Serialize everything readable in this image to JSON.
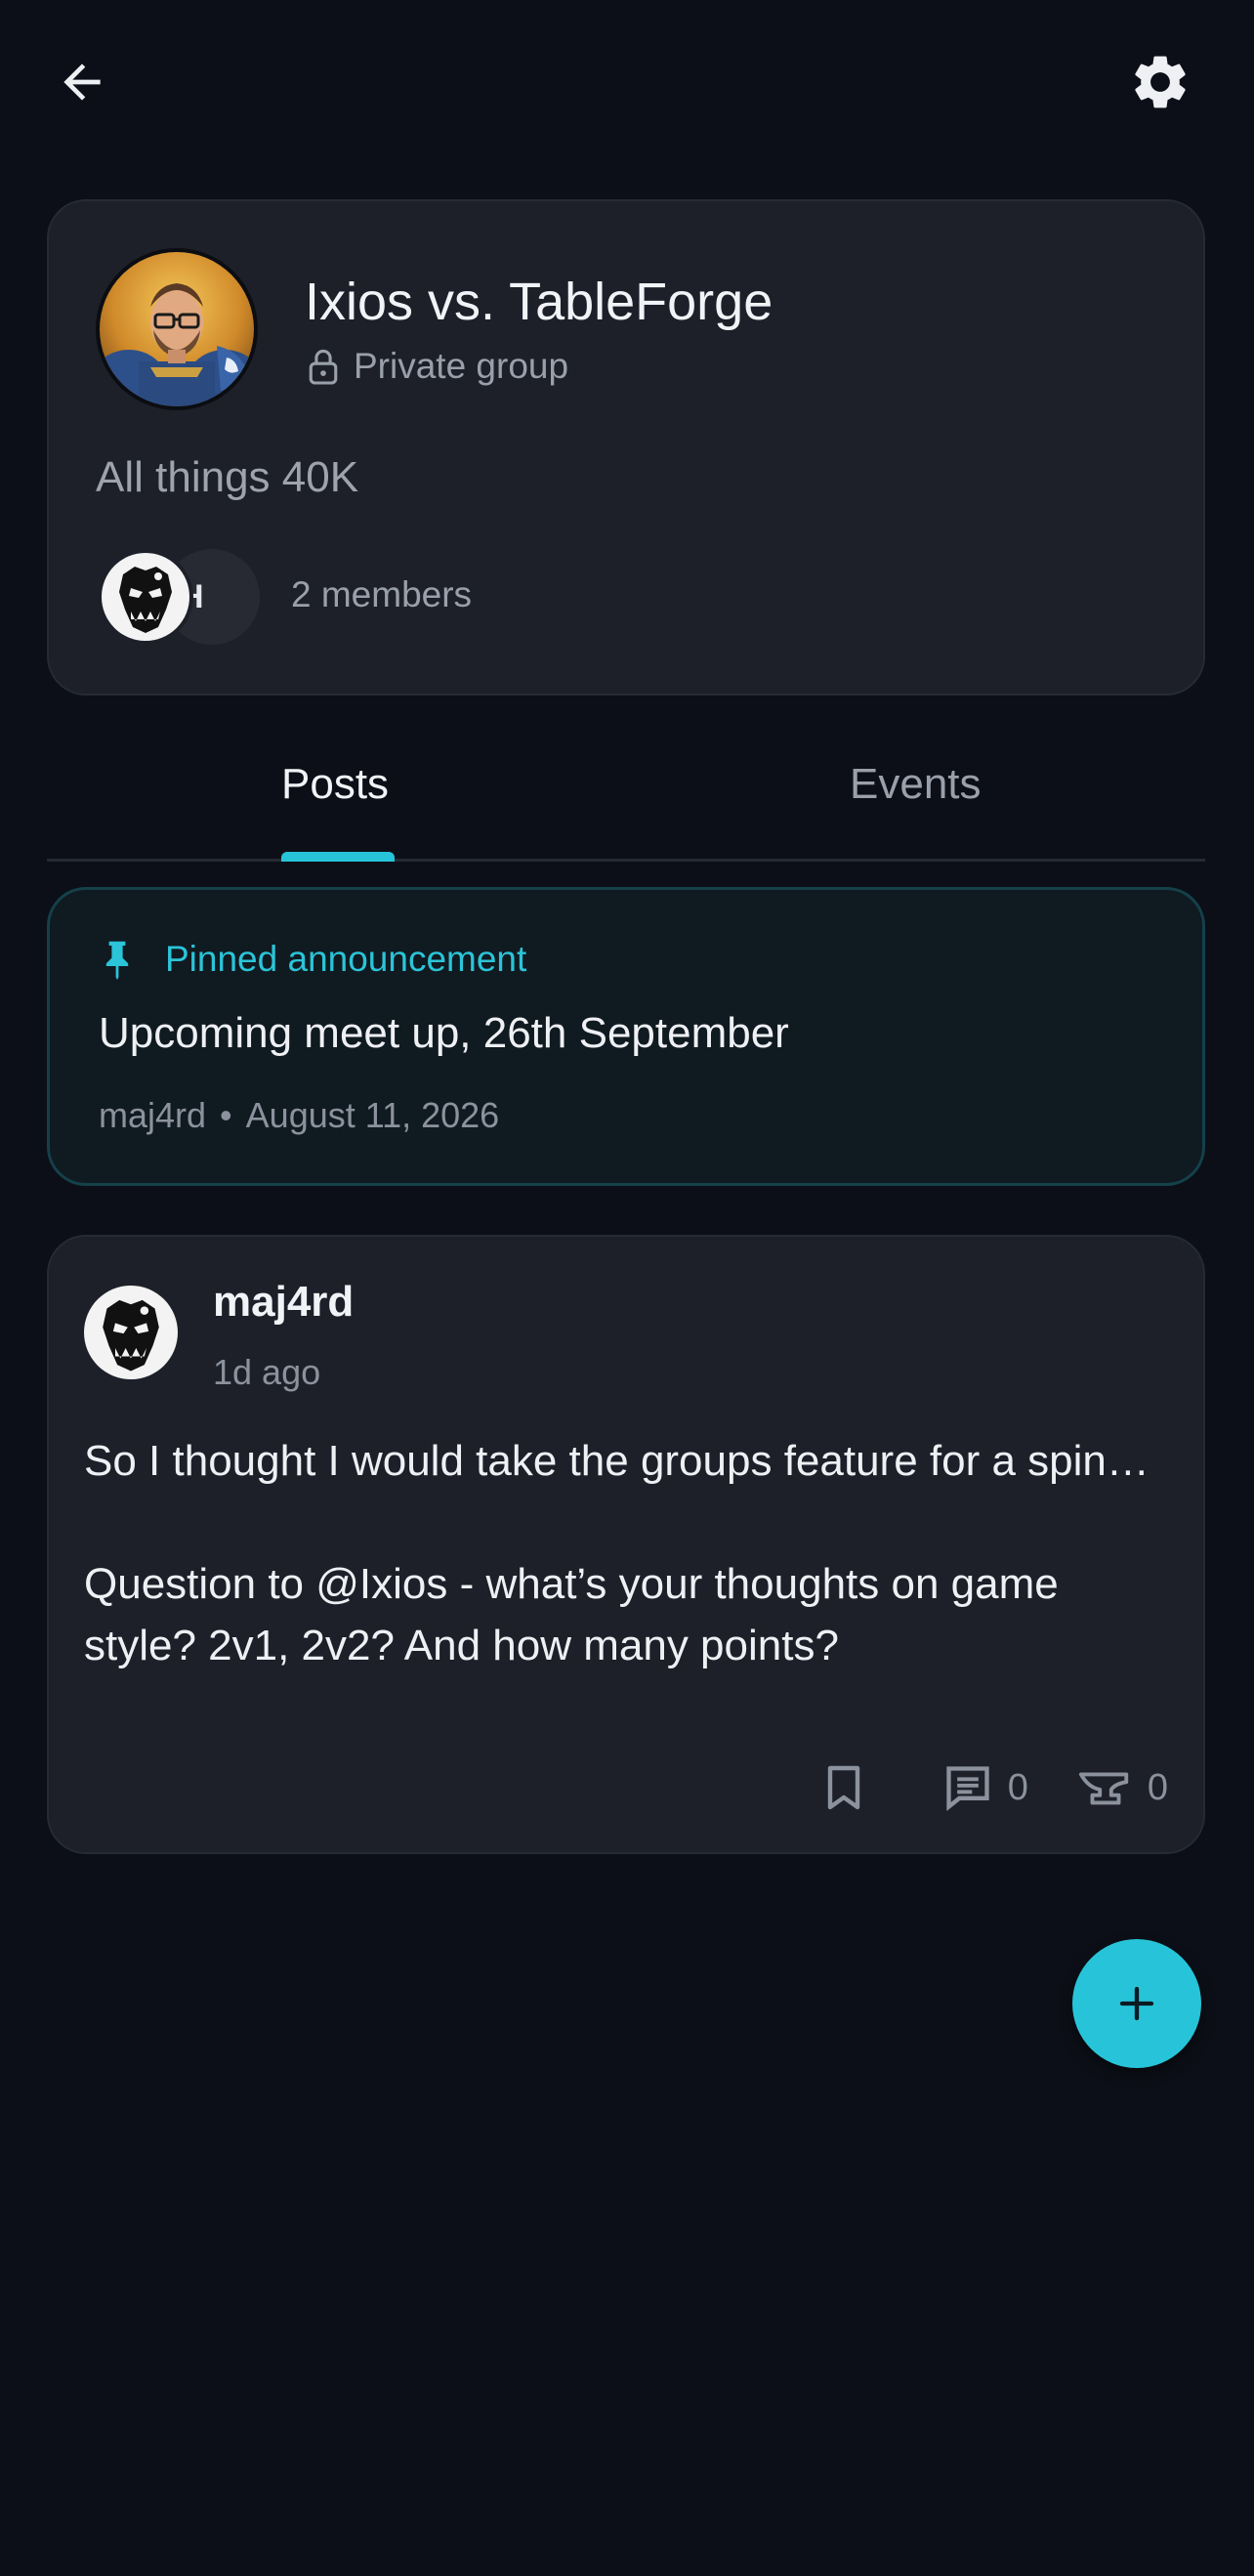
{
  "header": {
    "back_icon": "arrow-left-icon",
    "settings_icon": "gear-icon"
  },
  "group": {
    "name": "Ixios vs. TableForge",
    "privacy_label": "Private group",
    "description": "All things 40K",
    "member_initial": "H",
    "member_count_label": "2 members"
  },
  "tabs": [
    {
      "label": "Posts",
      "active": true
    },
    {
      "label": "Events",
      "active": false
    }
  ],
  "pinned": {
    "label": "Pinned announcement",
    "title": "Upcoming meet up, 26th September",
    "author": "maj4rd",
    "separator": "•",
    "date": "August 11, 2026"
  },
  "post": {
    "author": "maj4rd",
    "time": "1d ago",
    "body_paragraph_1": "So I thought I would take the groups feature for a spin…",
    "body_paragraph_2": "Question to @Ixios - what’s your thoughts on game style? 2v1, 2v2? And how many points?",
    "comment_count": "0",
    "anvil_count": "0"
  },
  "colors": {
    "background": "#0c0f17",
    "card": "#1d2029",
    "accent": "#27c4d9",
    "pinned_bg": "#101a21",
    "pinned_border": "#14414a"
  }
}
